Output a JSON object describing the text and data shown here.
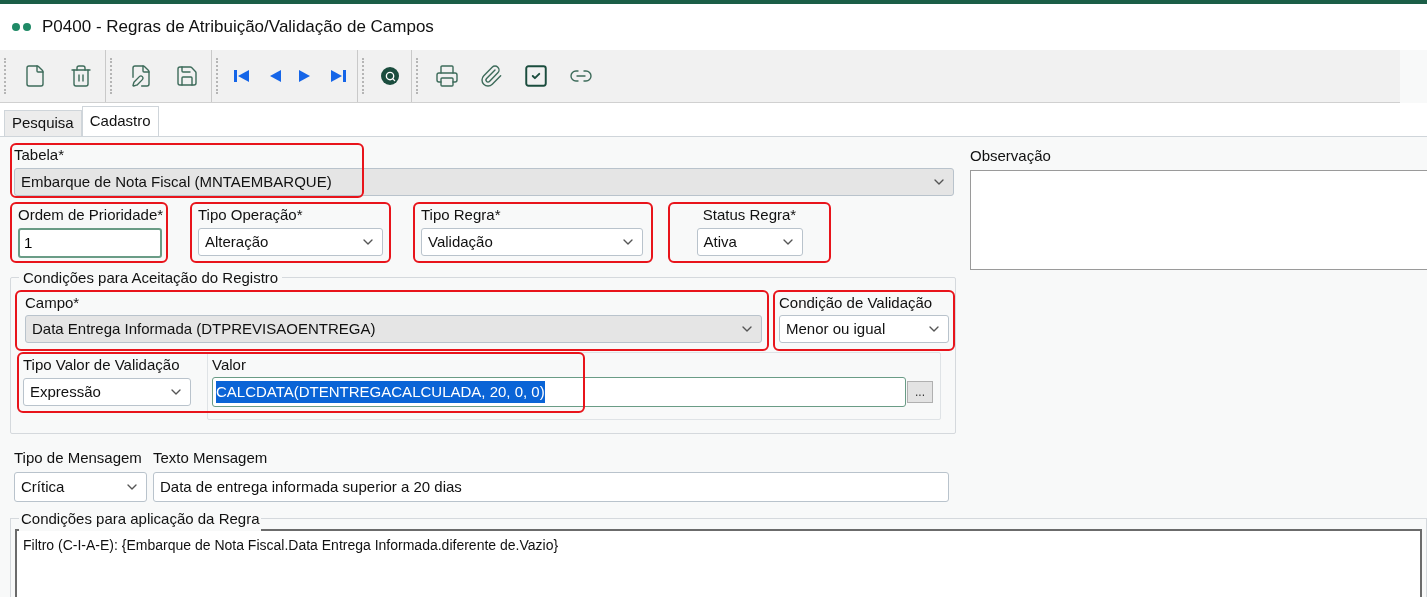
{
  "window": {
    "title": "P0400 - Regras de Atribuição/Validação de Campos"
  },
  "tabs": [
    {
      "label": "Pesquisa",
      "selected": false
    },
    {
      "label": "Cadastro",
      "selected": true
    }
  ],
  "tabela": {
    "label": "Tabela*",
    "value": "Embarque de Nota Fiscal (MNTAEMBARQUE)",
    "highlighted": true
  },
  "row_fields": [
    {
      "kind": "input",
      "label": "Ordem de Prioridade*",
      "value": "1",
      "highlighted": true
    },
    {
      "kind": "select",
      "label": "Tipo Operação*",
      "value": "Alteração",
      "highlighted": true
    },
    {
      "kind": "select",
      "label": "Tipo Regra*",
      "value": "Validação",
      "highlighted": true
    },
    {
      "kind": "select",
      "label": "Status Regra*",
      "value": "Ativa",
      "highlighted": true
    }
  ],
  "acceptance_group": {
    "title": "Condições para Aceitação do Registro",
    "campo": {
      "label": "Campo*",
      "value": "Data Entrega Informada (DTPREVISAOENTREGA)",
      "highlighted": true
    },
    "condicao": {
      "label": "Condição de Validação",
      "value": "Menor ou igual",
      "highlighted": true
    },
    "tipo_valor": {
      "label": "Tipo Valor de Validação",
      "value": "Expressão"
    },
    "valor": {
      "label": "Valor",
      "value": "CALCDATA(DTENTREGACALCULADA, 20, 0, 0)",
      "selected": true,
      "button": "..."
    },
    "valor_highlighted": true
  },
  "observacao": {
    "label": "Observação"
  },
  "tipo_mensagem": {
    "label": "Tipo de Mensagem",
    "value": "Crítica"
  },
  "texto_mensagem": {
    "label": "Texto Mensagem",
    "value": "Data de entrega informada superior a 20 dias"
  },
  "application_group": {
    "title": "Condições para aplicação da Regra",
    "text": "Filtro (C-I-A-E): {Embarque de Nota Fiscal.Data Entrega Informada.diferente de.Vazio}"
  }
}
